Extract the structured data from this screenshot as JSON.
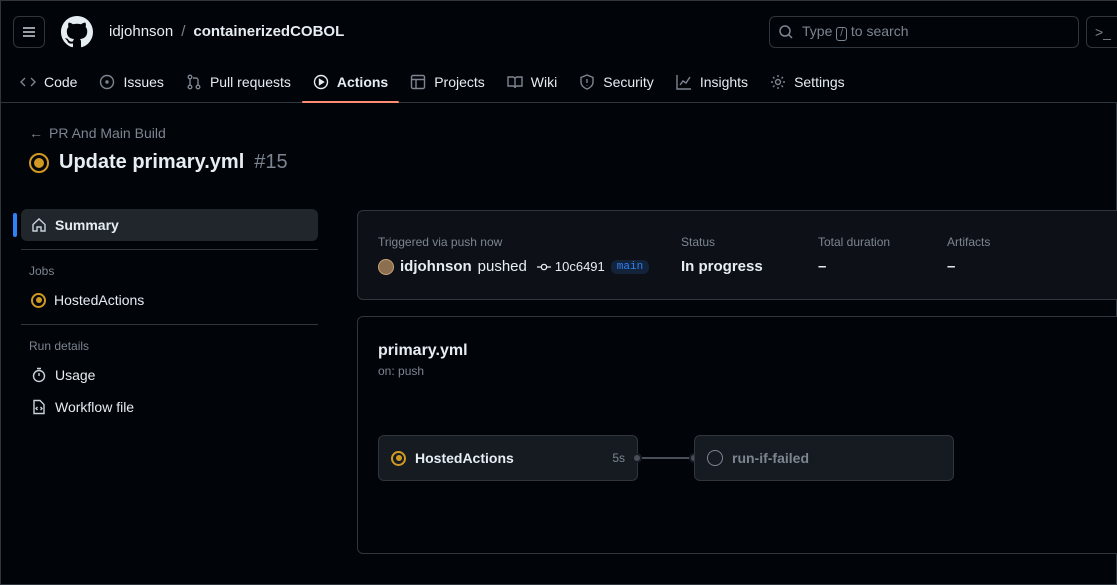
{
  "header": {
    "owner": "idjohnson",
    "separator": "/",
    "repo": "containerizedCOBOL",
    "search_prefix": "Type",
    "search_key": "/",
    "search_suffix": "to search",
    "command_glyph": ">_"
  },
  "tabs": [
    {
      "label": "Code",
      "icon": "code-icon"
    },
    {
      "label": "Issues",
      "icon": "issue-icon"
    },
    {
      "label": "Pull requests",
      "icon": "pull-request-icon"
    },
    {
      "label": "Actions",
      "icon": "play-icon",
      "active": true
    },
    {
      "label": "Projects",
      "icon": "table-icon"
    },
    {
      "label": "Wiki",
      "icon": "book-icon"
    },
    {
      "label": "Security",
      "icon": "shield-icon"
    },
    {
      "label": "Insights",
      "icon": "graph-icon"
    },
    {
      "label": "Settings",
      "icon": "gear-icon"
    }
  ],
  "run": {
    "back_label": "PR And Main Build",
    "title": "Update primary.yml",
    "number": "#15"
  },
  "sidebar": {
    "summary_label": "Summary",
    "jobs_heading": "Jobs",
    "job_label": "HostedActions",
    "details_heading": "Run details",
    "usage_label": "Usage",
    "workflow_file_label": "Workflow file"
  },
  "summary": {
    "trigger_label": "Triggered via push now",
    "actor": "idjohnson",
    "action": "pushed",
    "commit": "10c6491",
    "branch": "main",
    "status_label": "Status",
    "status_value": "In progress",
    "duration_label": "Total duration",
    "duration_value": "–",
    "artifacts_label": "Artifacts",
    "artifacts_value": "–"
  },
  "graph": {
    "workflow_name": "primary.yml",
    "trigger": "on: push",
    "jobs": [
      {
        "name": "HostedActions",
        "duration": "5s",
        "state": "in-progress"
      },
      {
        "name": "run-if-failed",
        "duration": "",
        "state": "pending"
      }
    ]
  },
  "colors": {
    "accent_in_progress": "#d29922",
    "tab_underline": "#fd8c73",
    "selection_bar": "#2f81f7"
  }
}
